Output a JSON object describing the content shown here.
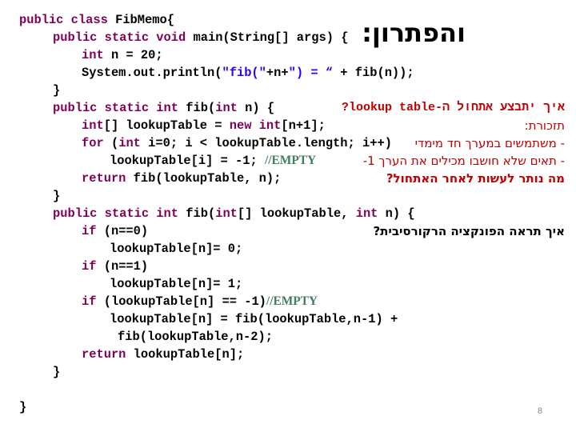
{
  "slide": {
    "title": "והפתרון:",
    "page_number": "8"
  },
  "code": {
    "l1_kw": "public class",
    "l1_rest": " FibMemo{",
    "l2_kw": "public static void",
    "l2_rest": " main(String[] args) {",
    "l3_kw": "int",
    "l3_rest": " n = 20;",
    "l4_a": "System.out.println(",
    "l4_str": "\"fib(\"",
    "l4_b": "+n+",
    "l4_str2": "\") = “",
    "l4_c": " + fib(n));",
    "l5": "}",
    "l6_kw": "public static int",
    "l6_b": " fib(",
    "l6_kw2": "int",
    "l6_c": " n) {",
    "l7_kw": "int",
    "l7_b": "[] lookupTable = ",
    "l7_kw2": "new int",
    "l7_c": "[n+1];",
    "l8_kw": "for",
    "l8_b": " (",
    "l8_kw2": "int",
    "l8_c": " i=0; i < lookupTable.length; i++)",
    "l9_a": "lookupTable[i] = -1; ",
    "l9_cmt": "//EMPTY",
    "l10_kw": "return",
    "l10_rest": " fib(lookupTable, n);",
    "l11": "}",
    "l12_kw": "public static int",
    "l12_b": " fib(",
    "l12_kw2": "int",
    "l12_c": "[] lookupTable, ",
    "l12_kw3": "int",
    "l12_d": " n) {",
    "l13_kw": "if",
    "l13_rest": " (n==0)",
    "l14": "lookupTable[n]= 0;",
    "l15_kw": "if",
    "l15_rest": " (n==1)",
    "l16": "lookupTable[n]= 1;",
    "l17_kw": "if",
    "l17_rest": " (lookupTable[n] == -1)",
    "l17_cmt": "//EMPTY",
    "l18": "lookupTable[n] = fib(lookupTable,n-1) +",
    "l19": "fib(lookupTable,n-2);",
    "l20_kw": "return",
    "l20_rest": " lookupTable[n];",
    "l21": "}",
    "l22": "}"
  },
  "annotations": {
    "q1": "איך יתבצע אתחול ה-lookup table?",
    "reminder": "תזכורת:",
    "bullet1": "- משתמשים במערך חד מימדי",
    "bullet2": "- תאים שלא חושבו מכילים את הערך 1-",
    "q2": "מה נותר לעשות לאחר האתחול?",
    "q3": "איך תראה הפונקציה הרקורסיבית?"
  },
  "colors": {
    "keyword": "#7f0055",
    "string": "#2a00ff",
    "comment": "#3f7f5f",
    "annotation_red": "#c00000"
  }
}
